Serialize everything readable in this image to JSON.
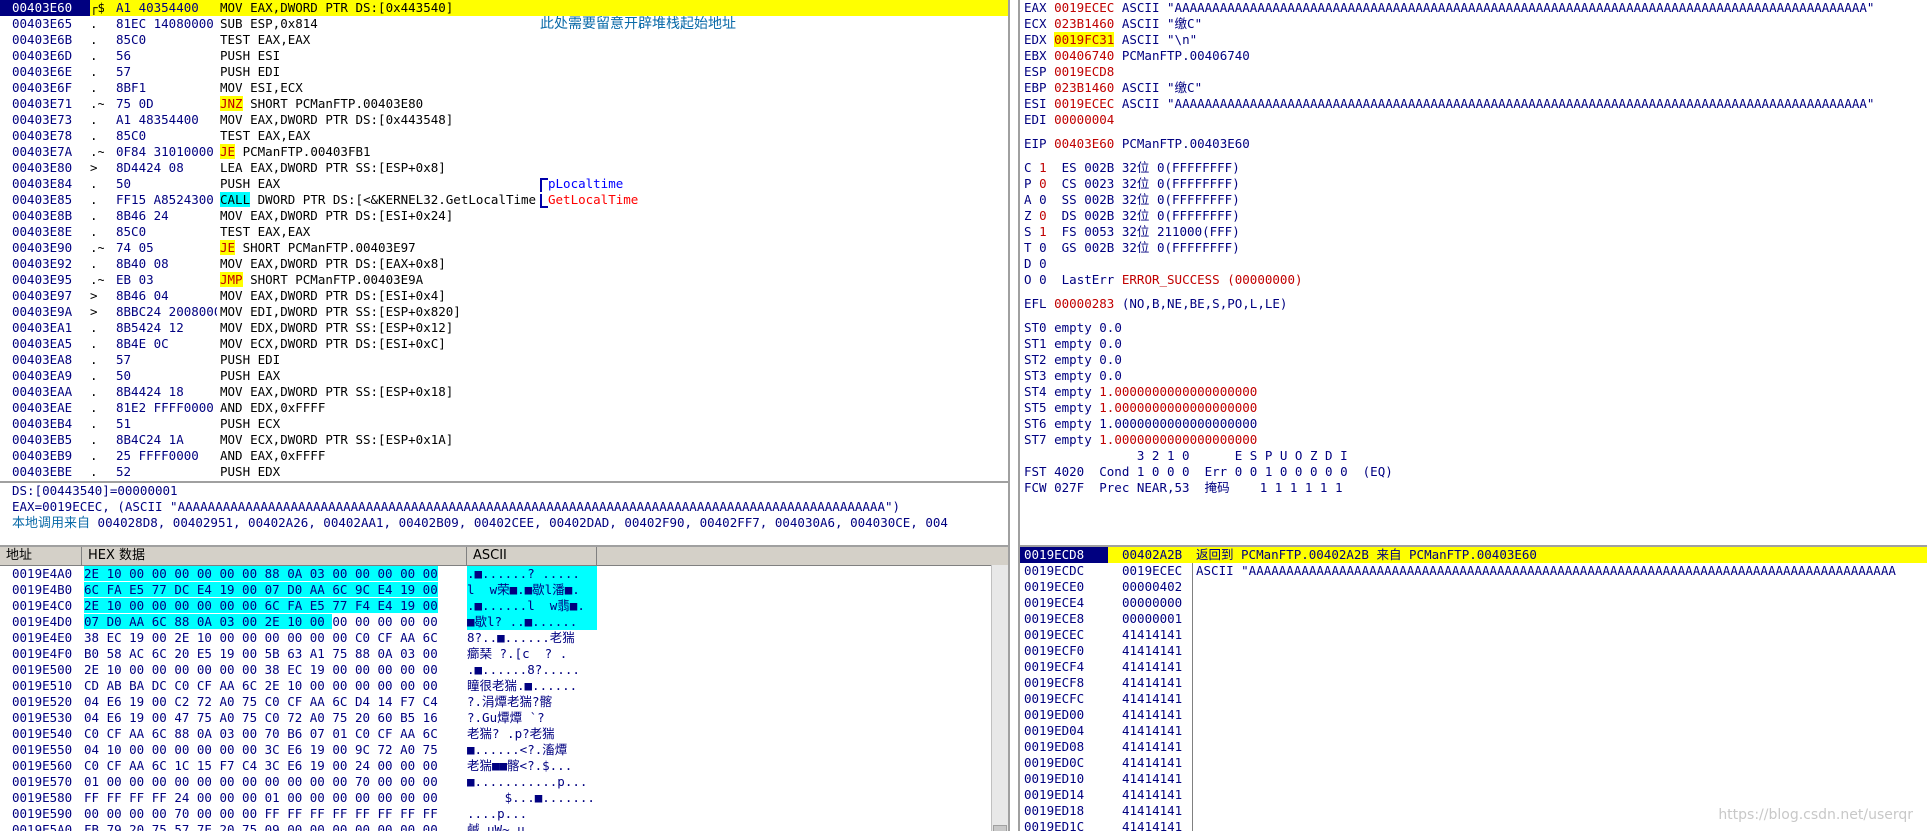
{
  "cpu": {
    "rows": [
      {
        "addr": "00403E60",
        "mk": "┌$",
        "hex": "A1 40354400",
        "dis": "MOV EAX,DWORD PTR DS:[0x443540]",
        "cmt": "",
        "sel": true
      },
      {
        "addr": "00403E65",
        "mk": ".",
        "hex": "81EC 14080000",
        "dis": "SUB ESP,0x814",
        "cmt": "此处需要留意开辟堆栈起始地址",
        "cmt_style": "cn"
      },
      {
        "addr": "00403E6B",
        "mk": ".",
        "hex": "85C0",
        "dis": "TEST EAX,EAX",
        "cmt": ""
      },
      {
        "addr": "00403E6D",
        "mk": ".",
        "hex": "56",
        "dis": "PUSH ESI",
        "cmt": ""
      },
      {
        "addr": "00403E6E",
        "mk": ".",
        "hex": "57",
        "dis": "PUSH EDI",
        "cmt": ""
      },
      {
        "addr": "00403E6F",
        "mk": ".",
        "hex": "8BF1",
        "dis": "MOV ESI,ECX",
        "cmt": ""
      },
      {
        "addr": "00403E71",
        "mk": ".~",
        "hex": "75 0D",
        "op": "JNZ",
        "rest": " SHORT PCManFTP.00403E80",
        "cmt": "",
        "jmp": true
      },
      {
        "addr": "00403E73",
        "mk": ".",
        "hex": "A1 48354400",
        "dis": "MOV EAX,DWORD PTR DS:[0x443548]",
        "cmt": ""
      },
      {
        "addr": "00403E78",
        "mk": ".",
        "hex": "85C0",
        "dis": "TEST EAX,EAX",
        "cmt": ""
      },
      {
        "addr": "00403E7A",
        "mk": ".~",
        "hex": "0F84 31010000",
        "op": "JE",
        "rest": " PCManFTP.00403FB1",
        "cmt": "",
        "jmp": true
      },
      {
        "addr": "00403E80",
        "mk": ">",
        "hex": "8D4424 08",
        "dis": "LEA EAX,DWORD PTR SS:[ESP+0x8]",
        "cmt": ""
      },
      {
        "addr": "00403E84",
        "mk": ".",
        "hex": "50",
        "dis": "PUSH EAX",
        "cmt": "pLocaltime",
        "cmt_style": "blue",
        "bracket": "start"
      },
      {
        "addr": "00403E85",
        "mk": ".",
        "hex": "FF15 A8524300",
        "op": "CALL",
        "rest": " DWORD PTR DS:[<&KERNEL32.GetLocalTime>]",
        "cmt": "GetLocalTime",
        "cmt_style": "red",
        "bracket": "end",
        "call": true
      },
      {
        "addr": "00403E8B",
        "mk": ".",
        "hex": "8B46 24",
        "dis": "MOV EAX,DWORD PTR DS:[ESI+0x24]",
        "cmt": ""
      },
      {
        "addr": "00403E8E",
        "mk": ".",
        "hex": "85C0",
        "dis": "TEST EAX,EAX",
        "cmt": ""
      },
      {
        "addr": "00403E90",
        "mk": ".~",
        "hex": "74 05",
        "op": "JE",
        "rest": " SHORT PCManFTP.00403E97",
        "cmt": "",
        "jmp": true
      },
      {
        "addr": "00403E92",
        "mk": ".",
        "hex": "8B40 08",
        "dis": "MOV EAX,DWORD PTR DS:[EAX+0x8]",
        "cmt": ""
      },
      {
        "addr": "00403E95",
        "mk": ".~",
        "hex": "EB 03",
        "op": "JMP",
        "rest": " SHORT PCManFTP.00403E9A",
        "cmt": "",
        "jmp": true
      },
      {
        "addr": "00403E97",
        "mk": ">",
        "hex": "8B46 04",
        "dis": "MOV EAX,DWORD PTR DS:[ESI+0x4]",
        "cmt": ""
      },
      {
        "addr": "00403E9A",
        "mk": ">",
        "hex": "8BBC24 20080000",
        "dis": "MOV EDI,DWORD PTR SS:[ESP+0x820]",
        "cmt": ""
      },
      {
        "addr": "00403EA1",
        "mk": ".",
        "hex": "8B5424 12",
        "dis": "MOV EDX,DWORD PTR SS:[ESP+0x12]",
        "cmt": ""
      },
      {
        "addr": "00403EA5",
        "mk": ".",
        "hex": "8B4E 0C",
        "dis": "MOV ECX,DWORD PTR DS:[ESI+0xC]",
        "cmt": ""
      },
      {
        "addr": "00403EA8",
        "mk": ".",
        "hex": "57",
        "dis": "PUSH EDI",
        "cmt": ""
      },
      {
        "addr": "00403EA9",
        "mk": ".",
        "hex": "50",
        "dis": "PUSH EAX",
        "cmt": ""
      },
      {
        "addr": "00403EAA",
        "mk": ".",
        "hex": "8B4424 18",
        "dis": "MOV EAX,DWORD PTR SS:[ESP+0x18]",
        "cmt": ""
      },
      {
        "addr": "00403EAE",
        "mk": ".",
        "hex": "81E2 FFFF0000",
        "dis": "AND EDX,0xFFFF",
        "cmt": ""
      },
      {
        "addr": "00403EB4",
        "mk": ".",
        "hex": "51",
        "dis": "PUSH ECX",
        "cmt": ""
      },
      {
        "addr": "00403EB5",
        "mk": ".",
        "hex": "8B4C24 1A",
        "dis": "MOV ECX,DWORD PTR SS:[ESP+0x1A]",
        "cmt": ""
      },
      {
        "addr": "00403EB9",
        "mk": ".",
        "hex": "25 FFFF0000",
        "dis": "AND EAX,0xFFFF",
        "cmt": ""
      },
      {
        "addr": "00403EBE",
        "mk": ".",
        "hex": "52",
        "dis": "PUSH EDX",
        "cmt": ""
      }
    ]
  },
  "info": {
    "line1": "DS:[00443540]=00000001",
    "line2": "EAX=0019ECEC, (ASCII \"AAAAAAAAAAAAAAAAAAAAAAAAAAAAAAAAAAAAAAAAAAAAAAAAAAAAAAAAAAAAAAAAAAAAAAAAAAAAAAAAAAAAAAAAAAAAAA\")",
    "line3_label": "本地调用来自",
    "line3_value": " 004028D8, 00402951, 00402A26, 00402AA1, 00402B09, 00402CEE, 00402DAD, 00402F90, 00402FF7, 004030A6, 004030CE, 004"
  },
  "dump": {
    "header_addr": "地址",
    "header_hex": "HEX 数据",
    "header_ascii": "ASCII",
    "rows": [
      {
        "addr": "0019E4A0",
        "hex": "2E 10 00 00 00 00 00 00 88 0A 03 00 00 00 00 00",
        "asc": ".■......? .....",
        "hl": 16
      },
      {
        "addr": "0019E4B0",
        "hex": "6C FA E5 77 DC E4 19 00 07 D0 AA 6C 9C E4 19 00",
        "asc": "l  w荣■.■歇l潘■.",
        "hl": 16
      },
      {
        "addr": "0019E4C0",
        "hex": "2E 10 00 00 00 00 00 00 6C FA E5 77 F4 E4 19 00",
        "asc": ".■......l  w翡■.",
        "hl": 16
      },
      {
        "addr": "0019E4D0",
        "hex": "07 D0 AA 6C 88 0A 03 00 2E 10 00 00 00 00 00 00",
        "asc": "■歇l? ..■......",
        "hl": 11
      },
      {
        "addr": "0019E4E0",
        "hex": "38 EC 19 00 2E 10 00 00 00 00 00 00 C0 CF AA 6C",
        "asc": "8?..■......老猯",
        "hl": 0
      },
      {
        "addr": "0019E4F0",
        "hex": "B0 58 AC 6C 20 E5 19 00 5B 63 A1 75 88 0A 03 00",
        "asc": "癤琹 ?.[c  ? .",
        "hl": 0
      },
      {
        "addr": "0019E500",
        "hex": "2E 10 00 00 00 00 00 00 38 EC 19 00 00 00 00 00",
        "asc": ".■......8?.....",
        "hl": 0
      },
      {
        "addr": "0019E510",
        "hex": "CD AB BA DC C0 CF AA 6C 2E 10 00 00 00 00 00 00",
        "asc": "瞳很老猯.■......",
        "hl": 0
      },
      {
        "addr": "0019E520",
        "hex": "04 E6 19 00 C2 72 A0 75 C0 CF AA 6C D4 14 F7 C4",
        "asc": "?.涓燂老猯?髂",
        "hl": 0
      },
      {
        "addr": "0019E530",
        "hex": "04 E6 19 00 47 75 A0 75 C0 72 A0 75 20 60 B5 16",
        "asc": "?.Gu燂燂 `?",
        "hl": 0
      },
      {
        "addr": "0019E540",
        "hex": "C0 CF AA 6C 88 0A 03 00 70 B6 07 01 C0 CF AA 6C",
        "asc": "老猯? .p?老猯",
        "hl": 0
      },
      {
        "addr": "0019E550",
        "hex": "04 10 00 00 00 00 00 00 3C E6 19 00 9C 72 A0 75",
        "asc": "■......<?.滀燂",
        "hl": 0
      },
      {
        "addr": "0019E560",
        "hex": "C0 CF AA 6C 1C 15 F7 C4 3C E6 19 00 24 00 00 00",
        "asc": "老猯■■髂<?.$...",
        "hl": 0
      },
      {
        "addr": "0019E570",
        "hex": "01 00 00 00 00 00 00 00 00 00 00 00 70 00 00 00",
        "asc": "■...........p...",
        "hl": 0
      },
      {
        "addr": "0019E580",
        "hex": "FF FF FF FF 24 00 00 00 01 00 00 00 00 00 00 00",
        "asc": "     $...■.......",
        "hl": 0
      },
      {
        "addr": "0019E590",
        "hex": "00 00 00 00 70 00 00 00 FF FF FF FF FF FF FF FF",
        "asc": "....p...        ",
        "hl": 0
      },
      {
        "addr": "0019E5A0",
        "hex": "FB 79 20 75 57 7E 20 75 09 00 00 00 00 00 00 00",
        "asc": "鹹 uW~ u........",
        "hl": 0
      }
    ]
  },
  "regs": {
    "gp": [
      {
        "name": "EAX",
        "val": "0019ECEC",
        "cmt": "ASCII \"AAAAAAAAAAAAAAAAAAAAAAAAAAAAAAAAAAAAAAAAAAAAAAAAAAAAAAAAAAAAAAAAAAAAAAAAAAAAAAAAAAAAAAAAAAAA\""
      },
      {
        "name": "ECX",
        "val": "023B1460",
        "cmt": "ASCII \"缴C\""
      },
      {
        "name": "EDX",
        "val": "0019FC31",
        "cmt": "ASCII \"\\n\"",
        "hl": true
      },
      {
        "name": "EBX",
        "val": "00406740",
        "cmt": "PCManFTP.00406740"
      },
      {
        "name": "ESP",
        "val": "0019ECD8",
        "cmt": ""
      },
      {
        "name": "EBP",
        "val": "023B1460",
        "cmt": "ASCII \"缴C\""
      },
      {
        "name": "ESI",
        "val": "0019ECEC",
        "cmt": "ASCII \"AAAAAAAAAAAAAAAAAAAAAAAAAAAAAAAAAAAAAAAAAAAAAAAAAAAAAAAAAAAAAAAAAAAAAAAAAAAAAAAAAAAAAAAAAAAA\""
      },
      {
        "name": "EDI",
        "val": "00000004",
        "cmt": ""
      }
    ],
    "eip": {
      "name": "EIP",
      "val": "00403E60",
      "cmt": "PCManFTP.00403E60"
    },
    "flags": [
      {
        "f": "C",
        "v": "1",
        "seg": "ES 002B 32位 0(FFFFFFFF)",
        "red": true
      },
      {
        "f": "P",
        "v": "0",
        "seg": "CS 0023 32位 0(FFFFFFFF)",
        "red": true
      },
      {
        "f": "A",
        "v": "0",
        "seg": "SS 002B 32位 0(FFFFFFFF)",
        "red": false
      },
      {
        "f": "Z",
        "v": "0",
        "seg": "DS 002B 32位 0(FFFFFFFF)",
        "red": true
      },
      {
        "f": "S",
        "v": "1",
        "seg": "FS 0053 32位 211000(FFF)",
        "red": true
      },
      {
        "f": "T",
        "v": "0",
        "seg": "GS 002B 32位 0(FFFFFFFF)",
        "red": false
      },
      {
        "f": "D",
        "v": "0",
        "seg": "",
        "red": false
      },
      {
        "f": "O",
        "v": "0",
        "seg": "LastErr ERROR_SUCCESS (00000000)",
        "red": false,
        "lasterr": true
      }
    ],
    "efl": {
      "label": "EFL",
      "val": "00000283",
      "cmt": "(NO,B,NE,BE,S,PO,L,LE)"
    },
    "fpu": [
      {
        "name": "ST0",
        "state": "empty",
        "val": "0.0",
        "red": false
      },
      {
        "name": "ST1",
        "state": "empty",
        "val": "0.0",
        "red": false
      },
      {
        "name": "ST2",
        "state": "empty",
        "val": "0.0",
        "red": false
      },
      {
        "name": "ST3",
        "state": "empty",
        "val": "0.0",
        "red": false
      },
      {
        "name": "ST4",
        "state": "empty",
        "val": "1.0000000000000000000",
        "red": true
      },
      {
        "name": "ST5",
        "state": "empty",
        "val": "1.0000000000000000000",
        "red": true
      },
      {
        "name": "ST6",
        "state": "empty",
        "val": "1.0000000000000000000",
        "red": false
      },
      {
        "name": "ST7",
        "state": "empty",
        "val": "1.0000000000000000000",
        "red": true
      }
    ],
    "fpu_hdr": "               3 2 1 0      E S P U O Z D I",
    "fst": "FST 4020  Cond 1 0 0 0  Err 0 0 1 0 0 0 0 0  (EQ)",
    "fcw": "FCW 027F  Prec NEAR,53  掩码    1 1 1 1 1 1"
  },
  "stack": {
    "rows": [
      {
        "addr": "0019ECD8",
        "val": "00402A2B",
        "cmt": "返回到 PCManFTP.00402A2B 来自 PCManFTP.00403E60",
        "sel": true
      },
      {
        "addr": "0019ECDC",
        "val": "0019ECEC",
        "cmt": "ASCII \"AAAAAAAAAAAAAAAAAAAAAAAAAAAAAAAAAAAAAAAAAAAAAAAAAAAAAAAAAAAAAAAAAAAAAAAAAAAAAAAAAAAAAA"
      },
      {
        "addr": "0019ECE0",
        "val": "00000402",
        "cmt": ""
      },
      {
        "addr": "0019ECE4",
        "val": "00000000",
        "cmt": ""
      },
      {
        "addr": "0019ECE8",
        "val": "00000001",
        "cmt": ""
      },
      {
        "addr": "0019ECEC",
        "val": "41414141",
        "cmt": ""
      },
      {
        "addr": "0019ECF0",
        "val": "41414141",
        "cmt": ""
      },
      {
        "addr": "0019ECF4",
        "val": "41414141",
        "cmt": ""
      },
      {
        "addr": "0019ECF8",
        "val": "41414141",
        "cmt": ""
      },
      {
        "addr": "0019ECFC",
        "val": "41414141",
        "cmt": ""
      },
      {
        "addr": "0019ED00",
        "val": "41414141",
        "cmt": ""
      },
      {
        "addr": "0019ED04",
        "val": "41414141",
        "cmt": ""
      },
      {
        "addr": "0019ED08",
        "val": "41414141",
        "cmt": ""
      },
      {
        "addr": "0019ED0C",
        "val": "41414141",
        "cmt": ""
      },
      {
        "addr": "0019ED10",
        "val": "41414141",
        "cmt": ""
      },
      {
        "addr": "0019ED14",
        "val": "41414141",
        "cmt": ""
      },
      {
        "addr": "0019ED18",
        "val": "41414141",
        "cmt": ""
      },
      {
        "addr": "0019ED1C",
        "val": "41414141",
        "cmt": ""
      }
    ]
  },
  "watermark": "https://blog.csdn.net/userqr"
}
